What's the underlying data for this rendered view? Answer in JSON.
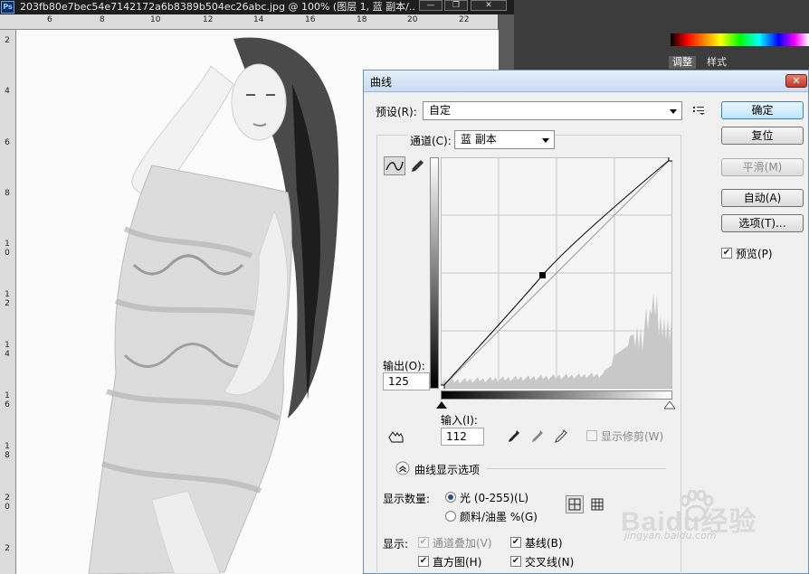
{
  "ps": {
    "logo": "Ps",
    "doc_title": "203fb80e7bec54e7142172a6b8389b504ec26abc.jpg @ 100% (图层 1, 蓝 副本/...",
    "win_min": "—",
    "win_restore": "❐",
    "win_close": "✕",
    "ruler_top_labels": [
      "6",
      "8",
      "10",
      "12",
      "14",
      "16",
      "18",
      "20",
      "22"
    ],
    "ruler_left_labels": [
      "2",
      "4",
      "6",
      "8",
      "1\n0",
      "1\n2",
      "1\n4",
      "1\n6",
      "1\n8",
      "2\n0",
      "2"
    ],
    "panel_tabs": [
      "调整",
      "样式"
    ]
  },
  "dialog": {
    "title": "曲线",
    "close_glyph": "✕",
    "preset_label": "预设(R):",
    "preset_value": "自定",
    "channel_label": "通道(C):",
    "channel_value": "蓝 副本",
    "output_label": "输出(O):",
    "output_value": "125",
    "input_label": "输入(I):",
    "input_value": "112",
    "show_clipping_label": "显示修剪(W)",
    "curve_options_label": "曲线显示选项",
    "show_amount_label": "显示数量:",
    "light_label": "光 (0-255)(L)",
    "pigment_label": "颜料/油墨 %(G)",
    "show_label": "显示:",
    "channel_overlays_label": "通道叠加(V)",
    "baseline_label": "基线(B)",
    "histogram_label": "直方图(H)",
    "intersection_label": "交叉线(N)",
    "buttons": {
      "ok": "确定",
      "reset": "复位",
      "smooth": "平滑(M)",
      "auto": "自动(A)",
      "options": "选项(T)..."
    },
    "preview_label": "预览(P)"
  },
  "curve": {
    "points": [
      [
        0,
        0
      ],
      [
        112,
        125
      ],
      [
        255,
        255
      ]
    ],
    "range": [
      0,
      255
    ]
  },
  "watermark": {
    "brand": "Baidu经验",
    "url": "jingyan.baidu.com"
  }
}
